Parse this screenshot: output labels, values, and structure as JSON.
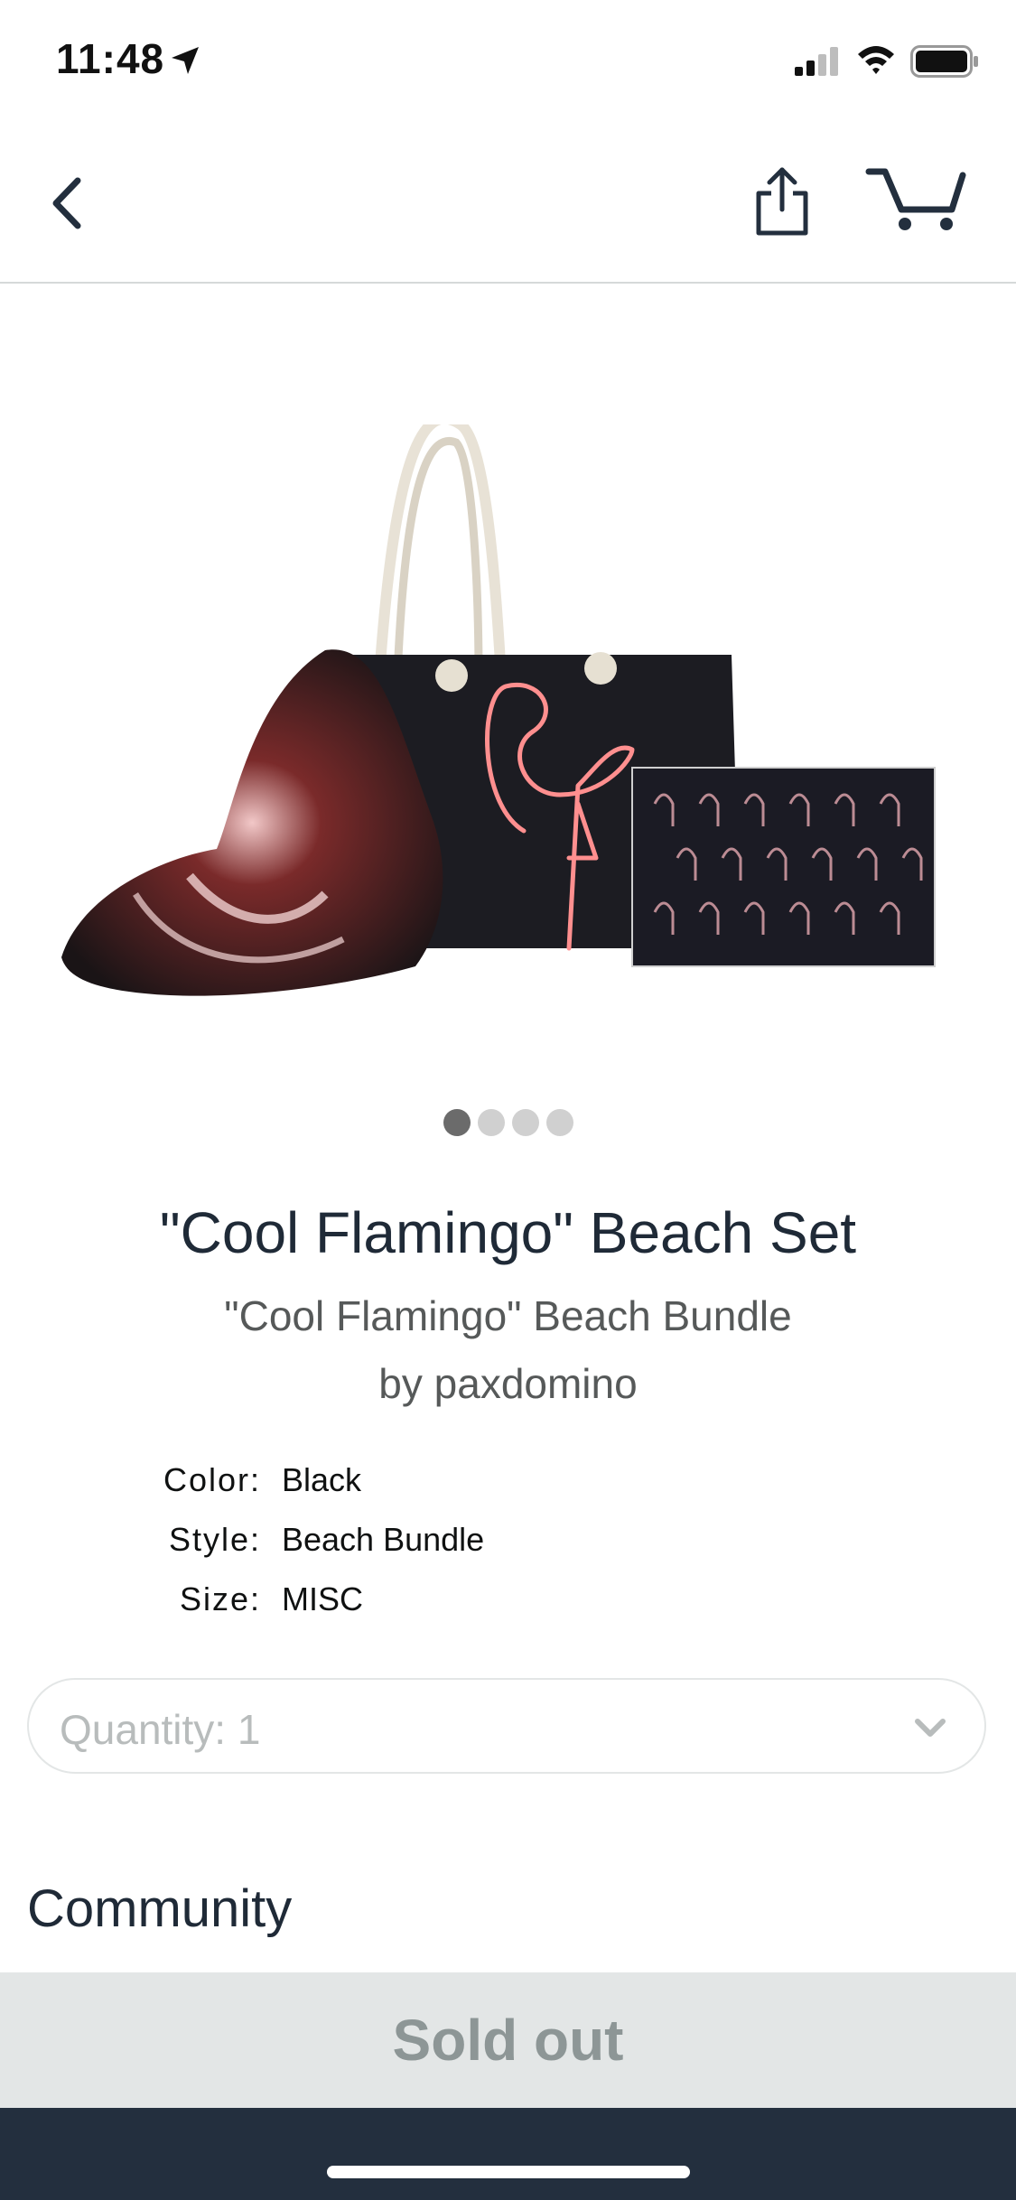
{
  "status": {
    "time": "11:48"
  },
  "product": {
    "title": "\"Cool Flamingo\" Beach Set",
    "subtitle": "\"Cool Flamingo\" Beach Bundle",
    "byline": "by paxdomino",
    "image_count": 4,
    "active_image_index": 0
  },
  "attributes": [
    {
      "key": "Color:",
      "value": "Black"
    },
    {
      "key": "Style:",
      "value": "Beach Bundle"
    },
    {
      "key": "Size:",
      "value": "MISC"
    }
  ],
  "quantity": {
    "label": "Quantity: 1"
  },
  "community": {
    "heading": "Community"
  },
  "action": {
    "label": "Sold out"
  },
  "colors": {
    "navy": "#232f3e",
    "soldout_bg": "#e3e6e6",
    "soldout_text": "#8d9696"
  }
}
